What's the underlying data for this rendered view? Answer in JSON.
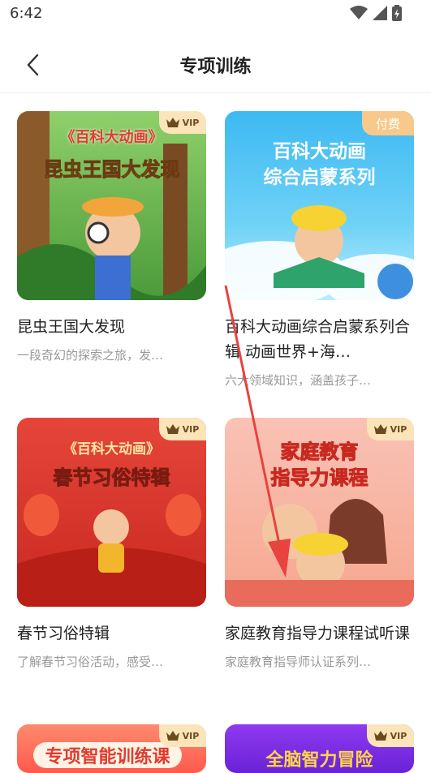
{
  "status_bar": {
    "time": "6:42"
  },
  "header": {
    "title": "专项训练",
    "back_icon": "chevron-left-icon"
  },
  "badges": {
    "paid_label": "付费",
    "vip_icon": "crown-icon"
  },
  "cards": [
    {
      "thumb_line1": "《百科大动画》",
      "thumb_line2": "昆虫王国大发现",
      "title": "昆虫王国大发现",
      "description": "一段奇幻的探索之旅，发…",
      "badge": "vip"
    },
    {
      "thumb_line1": "百科大动画",
      "thumb_line2": "综合启蒙系列",
      "title": "百科大动画综合启蒙系列合辑  动画世界+海…",
      "description": "六大领域知识，涵盖孩子…",
      "badge": "paid"
    },
    {
      "thumb_line1": "《百科大动画》",
      "thumb_line2": "春节习俗特辑",
      "title": "春节习俗特辑",
      "description": "了解春节习俗活动，感受…",
      "badge": "vip"
    },
    {
      "thumb_line1": "家庭教育",
      "thumb_line2": "指导力课程",
      "title": "家庭教育指导力课程试听课",
      "description": "家庭教育指导师认证系列…",
      "badge": "vip"
    },
    {
      "thumb_line1": "专项智能训练课",
      "title": "",
      "description": "",
      "badge": "vip"
    },
    {
      "thumb_line1": "全脑智力冒险",
      "title": "",
      "description": "",
      "badge": "vip"
    }
  ],
  "colors": {
    "card1_bg": "#5fa843",
    "card2_bg": "#3aa6e8",
    "card3_bg": "#e23b2e",
    "card4_bg": "#f7b3a6",
    "card5_bg": "#ff6a5c",
    "card6_bg": "#7b2fe0",
    "arrow": "#e8433f"
  }
}
